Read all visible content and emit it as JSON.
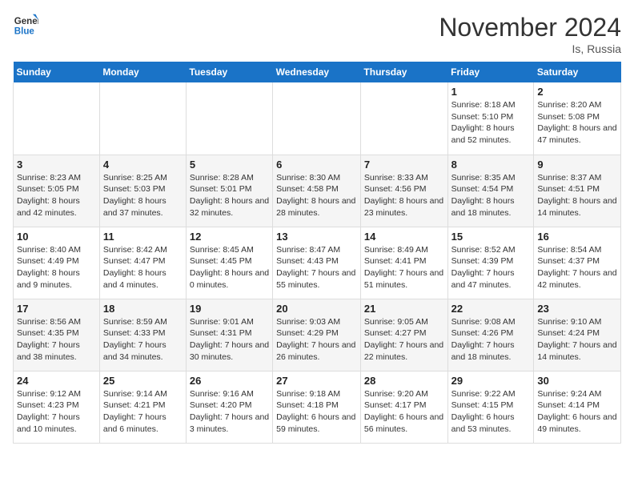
{
  "header": {
    "logo_line1": "General",
    "logo_line2": "Blue",
    "month": "November 2024",
    "location": "Is, Russia"
  },
  "weekdays": [
    "Sunday",
    "Monday",
    "Tuesday",
    "Wednesday",
    "Thursday",
    "Friday",
    "Saturday"
  ],
  "weeks": [
    [
      {
        "day": "",
        "detail": ""
      },
      {
        "day": "",
        "detail": ""
      },
      {
        "day": "",
        "detail": ""
      },
      {
        "day": "",
        "detail": ""
      },
      {
        "day": "",
        "detail": ""
      },
      {
        "day": "1",
        "detail": "Sunrise: 8:18 AM\nSunset: 5:10 PM\nDaylight: 8 hours and 52 minutes."
      },
      {
        "day": "2",
        "detail": "Sunrise: 8:20 AM\nSunset: 5:08 PM\nDaylight: 8 hours and 47 minutes."
      }
    ],
    [
      {
        "day": "3",
        "detail": "Sunrise: 8:23 AM\nSunset: 5:05 PM\nDaylight: 8 hours and 42 minutes."
      },
      {
        "day": "4",
        "detail": "Sunrise: 8:25 AM\nSunset: 5:03 PM\nDaylight: 8 hours and 37 minutes."
      },
      {
        "day": "5",
        "detail": "Sunrise: 8:28 AM\nSunset: 5:01 PM\nDaylight: 8 hours and 32 minutes."
      },
      {
        "day": "6",
        "detail": "Sunrise: 8:30 AM\nSunset: 4:58 PM\nDaylight: 8 hours and 28 minutes."
      },
      {
        "day": "7",
        "detail": "Sunrise: 8:33 AM\nSunset: 4:56 PM\nDaylight: 8 hours and 23 minutes."
      },
      {
        "day": "8",
        "detail": "Sunrise: 8:35 AM\nSunset: 4:54 PM\nDaylight: 8 hours and 18 minutes."
      },
      {
        "day": "9",
        "detail": "Sunrise: 8:37 AM\nSunset: 4:51 PM\nDaylight: 8 hours and 14 minutes."
      }
    ],
    [
      {
        "day": "10",
        "detail": "Sunrise: 8:40 AM\nSunset: 4:49 PM\nDaylight: 8 hours and 9 minutes."
      },
      {
        "day": "11",
        "detail": "Sunrise: 8:42 AM\nSunset: 4:47 PM\nDaylight: 8 hours and 4 minutes."
      },
      {
        "day": "12",
        "detail": "Sunrise: 8:45 AM\nSunset: 4:45 PM\nDaylight: 8 hours and 0 minutes."
      },
      {
        "day": "13",
        "detail": "Sunrise: 8:47 AM\nSunset: 4:43 PM\nDaylight: 7 hours and 55 minutes."
      },
      {
        "day": "14",
        "detail": "Sunrise: 8:49 AM\nSunset: 4:41 PM\nDaylight: 7 hours and 51 minutes."
      },
      {
        "day": "15",
        "detail": "Sunrise: 8:52 AM\nSunset: 4:39 PM\nDaylight: 7 hours and 47 minutes."
      },
      {
        "day": "16",
        "detail": "Sunrise: 8:54 AM\nSunset: 4:37 PM\nDaylight: 7 hours and 42 minutes."
      }
    ],
    [
      {
        "day": "17",
        "detail": "Sunrise: 8:56 AM\nSunset: 4:35 PM\nDaylight: 7 hours and 38 minutes."
      },
      {
        "day": "18",
        "detail": "Sunrise: 8:59 AM\nSunset: 4:33 PM\nDaylight: 7 hours and 34 minutes."
      },
      {
        "day": "19",
        "detail": "Sunrise: 9:01 AM\nSunset: 4:31 PM\nDaylight: 7 hours and 30 minutes."
      },
      {
        "day": "20",
        "detail": "Sunrise: 9:03 AM\nSunset: 4:29 PM\nDaylight: 7 hours and 26 minutes."
      },
      {
        "day": "21",
        "detail": "Sunrise: 9:05 AM\nSunset: 4:27 PM\nDaylight: 7 hours and 22 minutes."
      },
      {
        "day": "22",
        "detail": "Sunrise: 9:08 AM\nSunset: 4:26 PM\nDaylight: 7 hours and 18 minutes."
      },
      {
        "day": "23",
        "detail": "Sunrise: 9:10 AM\nSunset: 4:24 PM\nDaylight: 7 hours and 14 minutes."
      }
    ],
    [
      {
        "day": "24",
        "detail": "Sunrise: 9:12 AM\nSunset: 4:23 PM\nDaylight: 7 hours and 10 minutes."
      },
      {
        "day": "25",
        "detail": "Sunrise: 9:14 AM\nSunset: 4:21 PM\nDaylight: 7 hours and 6 minutes."
      },
      {
        "day": "26",
        "detail": "Sunrise: 9:16 AM\nSunset: 4:20 PM\nDaylight: 7 hours and 3 minutes."
      },
      {
        "day": "27",
        "detail": "Sunrise: 9:18 AM\nSunset: 4:18 PM\nDaylight: 6 hours and 59 minutes."
      },
      {
        "day": "28",
        "detail": "Sunrise: 9:20 AM\nSunset: 4:17 PM\nDaylight: 6 hours and 56 minutes."
      },
      {
        "day": "29",
        "detail": "Sunrise: 9:22 AM\nSunset: 4:15 PM\nDaylight: 6 hours and 53 minutes."
      },
      {
        "day": "30",
        "detail": "Sunrise: 9:24 AM\nSunset: 4:14 PM\nDaylight: 6 hours and 49 minutes."
      }
    ]
  ]
}
